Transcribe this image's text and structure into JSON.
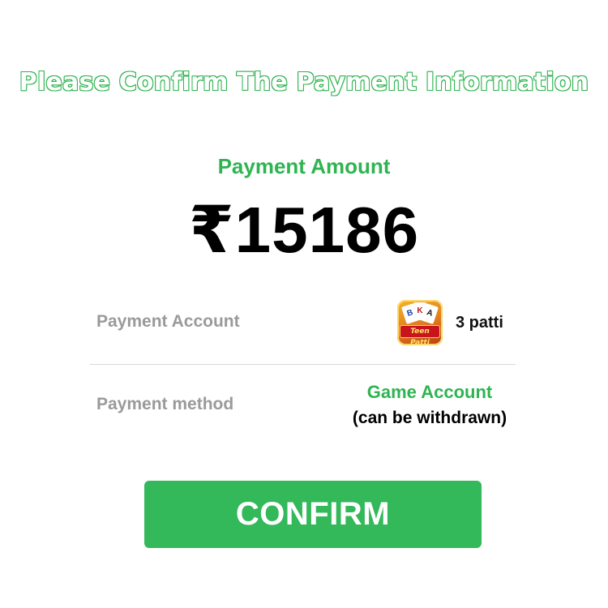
{
  "header": {
    "title": "Please Confirm The Payment Information"
  },
  "amount": {
    "label": "Payment Amount",
    "value": "₹15186"
  },
  "account": {
    "label": "Payment Account",
    "app_icon": "teen-patti-app-icon",
    "app_icon_text": "Teen Patti",
    "name": "3 patti"
  },
  "method": {
    "label": "Payment method",
    "value": "Game Account",
    "note": "(can be withdrawn)"
  },
  "confirm": {
    "label": "CONFIRM"
  },
  "colors": {
    "accent": "#2fb451",
    "button": "#33b85a",
    "label_gray": "#9a9a9a",
    "text": "#000000"
  }
}
